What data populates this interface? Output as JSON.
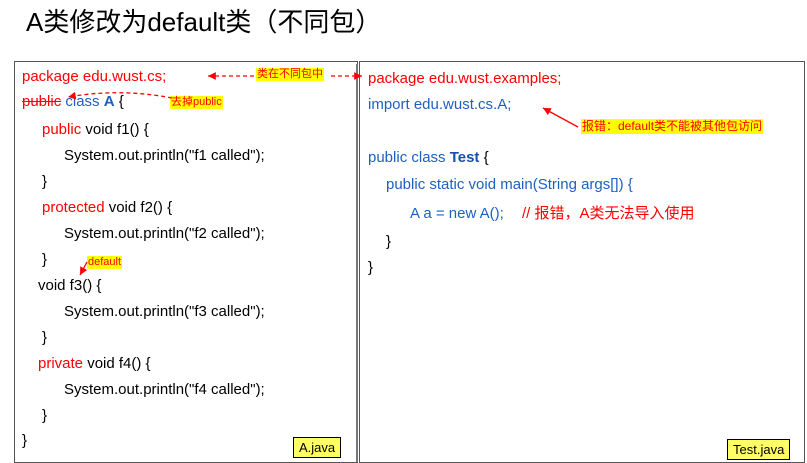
{
  "title": "A类修改为default类（不同包）",
  "left_panel": {
    "file_label": "A.java",
    "line1": "package edu.wust.cs;",
    "line2_public": "public",
    "line2_class": " class ",
    "line2_name": "A",
    "line2_brace": " {",
    "f1_mod": "public",
    "f1_rest": "  void f1() {",
    "f1_body": "System.out.println(\"f1 called\");",
    "close1": "}",
    "f2_mod": "protected",
    "f2_rest": " void f2() {",
    "f2_body": "System.out.println(\"f2 called\");",
    "close2": "}",
    "f3_decl": "void f3() {",
    "f3_body": "System.out.println(\"f3 called\");",
    "close3": "}",
    "f4_mod": "private",
    "f4_rest": " void f4() {",
    "f4_body": "System.out.println(\"f4 called\");",
    "close4": "}",
    "class_close": "}"
  },
  "right_panel": {
    "file_label": "Test.java",
    "line1": "package edu.wust.examples;",
    "line2": "import edu.wust.cs.A;",
    "line3_pre": "public class ",
    "line3_name": "Test",
    "line3_post": " {",
    "main_decl": "public static void main(String args[]) {",
    "stmt": "A a = new A();",
    "stmt_comment": "// 报错，A类无法导入使用",
    "close_main": "}",
    "close_class": "}"
  },
  "annotations": {
    "different_package": "类在不同包中",
    "remove_public": "去掉public",
    "default_label": "default",
    "error_msg": "报错：default类不能被其他包访问"
  },
  "colors": {
    "keyword_red": "#ff0000",
    "import_blue": "#1f5fbf",
    "note_bg": "#ffff00",
    "file_tag_bg": "#ffff66"
  }
}
